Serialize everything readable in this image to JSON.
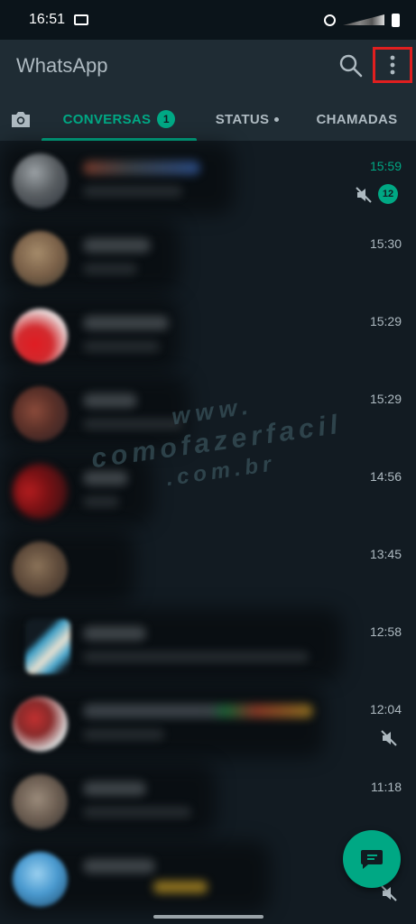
{
  "status_bar": {
    "time": "16:51"
  },
  "app_bar": {
    "title": "WhatsApp",
    "icons": [
      "search-icon",
      "more-vert-icon"
    ],
    "highlight_color": "#e01f1f"
  },
  "tabs": {
    "camera_icon": "camera-icon",
    "items": [
      {
        "label": "CONVERSAS",
        "badge": "1",
        "active": true
      },
      {
        "label": "STATUS",
        "has_dot": true,
        "active": false
      },
      {
        "label": "CHAMADAS",
        "active": false
      }
    ]
  },
  "chats": [
    {
      "time": "15:59",
      "unread": "12",
      "muted": true
    },
    {
      "time": "15:30"
    },
    {
      "time": "15:29"
    },
    {
      "time": "15:29"
    },
    {
      "time": "14:56"
    },
    {
      "time": "13:45"
    },
    {
      "time": "12:58"
    },
    {
      "time": "12:04",
      "muted": true
    },
    {
      "time": "11:18"
    },
    {
      "time": "",
      "muted": true
    }
  ],
  "watermark": {
    "line1": "www.",
    "line2": "comofazerfacil",
    "line3": ".com.br"
  },
  "fab": {
    "icon": "new-chat-icon"
  },
  "colors": {
    "accent": "#00a884",
    "header": "#1f2c34",
    "background": "#121b22"
  }
}
